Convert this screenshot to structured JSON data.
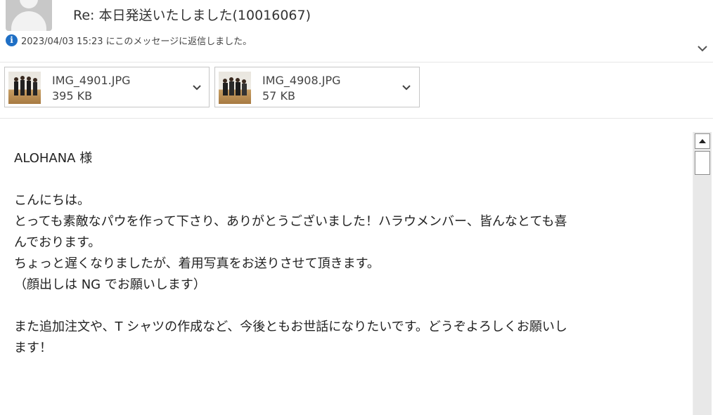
{
  "header": {
    "subject": "Re: 本日発送いたしました(10016067)",
    "reply_info": "2023/04/03 15:23 にこのメッセージに返信しました。"
  },
  "attachments": [
    {
      "name": "IMG_4901.JPG",
      "size": "395 KB"
    },
    {
      "name": "IMG_4908.JPG",
      "size": "57 KB"
    }
  ],
  "body": {
    "lines": [
      "ALOHANA 様",
      "",
      "こんにちは。",
      "とっても素敵なパウを作って下さり、ありがとうございました！ハラウメンバー、皆んなとても喜",
      "んでおります。",
      "ちょっと遅くなりましたが、着用写真をお送りさせて頂きます。",
      "（顔出しは NG でお願いします）",
      "",
      "また追加注文や、T シャツの作成など、今後ともお世話になりたいです。どうぞよろしくお願いし",
      "ます！"
    ]
  },
  "icons": {
    "info": "info-icon",
    "expand": "chevron-down-icon",
    "attachment_menu": "chevron-down-icon",
    "scroll_up": "arrow-up-icon"
  },
  "colors": {
    "info_icon": "#1f6fc5",
    "scrollbar_track": "#e8e8e8"
  }
}
